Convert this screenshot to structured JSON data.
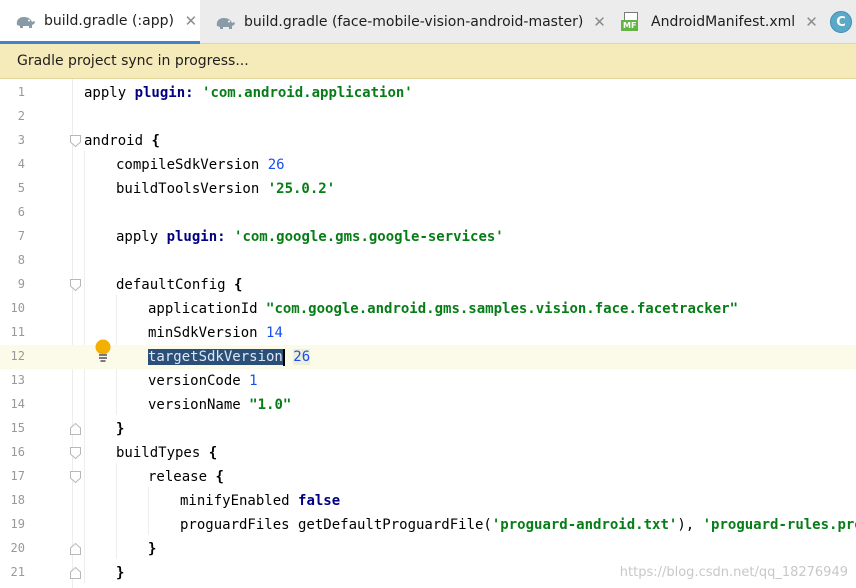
{
  "tabs": [
    {
      "label": "build.gradle (:app)",
      "icon": "gradle-elephant-icon",
      "active": true
    },
    {
      "label": "build.gradle (face-mobile-vision-android-master)",
      "icon": "gradle-elephant-icon",
      "active": false
    },
    {
      "label": "AndroidManifest.xml",
      "icon": "manifest-file-icon",
      "active": false
    },
    {
      "label": "C",
      "icon": "class-icon",
      "active": false
    }
  ],
  "banner": {
    "text": "Gradle project sync in progress..."
  },
  "editor": {
    "current_line": 12,
    "lines": [
      {
        "n": "1"
      },
      {
        "n": "2"
      },
      {
        "n": "3"
      },
      {
        "n": "4"
      },
      {
        "n": "5"
      },
      {
        "n": "6"
      },
      {
        "n": "7"
      },
      {
        "n": "8"
      },
      {
        "n": "9"
      },
      {
        "n": "10"
      },
      {
        "n": "11"
      },
      {
        "n": "12"
      },
      {
        "n": "13"
      },
      {
        "n": "14"
      },
      {
        "n": "15"
      },
      {
        "n": "16"
      },
      {
        "n": "17"
      },
      {
        "n": "18"
      },
      {
        "n": "19"
      },
      {
        "n": "20"
      },
      {
        "n": "21"
      }
    ],
    "code": {
      "l1_a": "apply ",
      "l1_b": "plugin",
      "l1_c": ": ",
      "l1_d": "'com.android.application'",
      "l3_a": "android ",
      "l3_b": "{",
      "l4_a": "compileSdkVersion ",
      "l4_b": "26",
      "l5_a": "buildToolsVersion ",
      "l5_b": "'25.0.2'",
      "l7_a": "apply ",
      "l7_b": "plugin",
      "l7_c": ": ",
      "l7_d": "'com.google.gms.google-services'",
      "l9_a": "defaultConfig ",
      "l9_b": "{",
      "l10_a": "applicationId ",
      "l10_b": "\"com.google.android.gms.samples.vision.face.facetracker\"",
      "l11_a": "minSdkVersion ",
      "l11_b": "14",
      "l12_a": "targetSdkVersion",
      "l12_b": " ",
      "l12_c": "26",
      "l13_a": "versionCode ",
      "l13_b": "1",
      "l14_a": "versionName ",
      "l14_b": "\"1.0\"",
      "l15_a": "}",
      "l16_a": "buildTypes ",
      "l16_b": "{",
      "l17_a": "release ",
      "l17_b": "{",
      "l18_a": "minifyEnabled ",
      "l18_b": "false",
      "l19_a": "proguardFiles getDefaultProguardFile(",
      "l19_b": "'proguard-android.txt'",
      "l19_c": "), ",
      "l19_d": "'proguard-rules.pro'",
      "l20_a": "}",
      "l21_a": "}"
    }
  },
  "watermark": "https://blog.csdn.net/qq_18276949"
}
